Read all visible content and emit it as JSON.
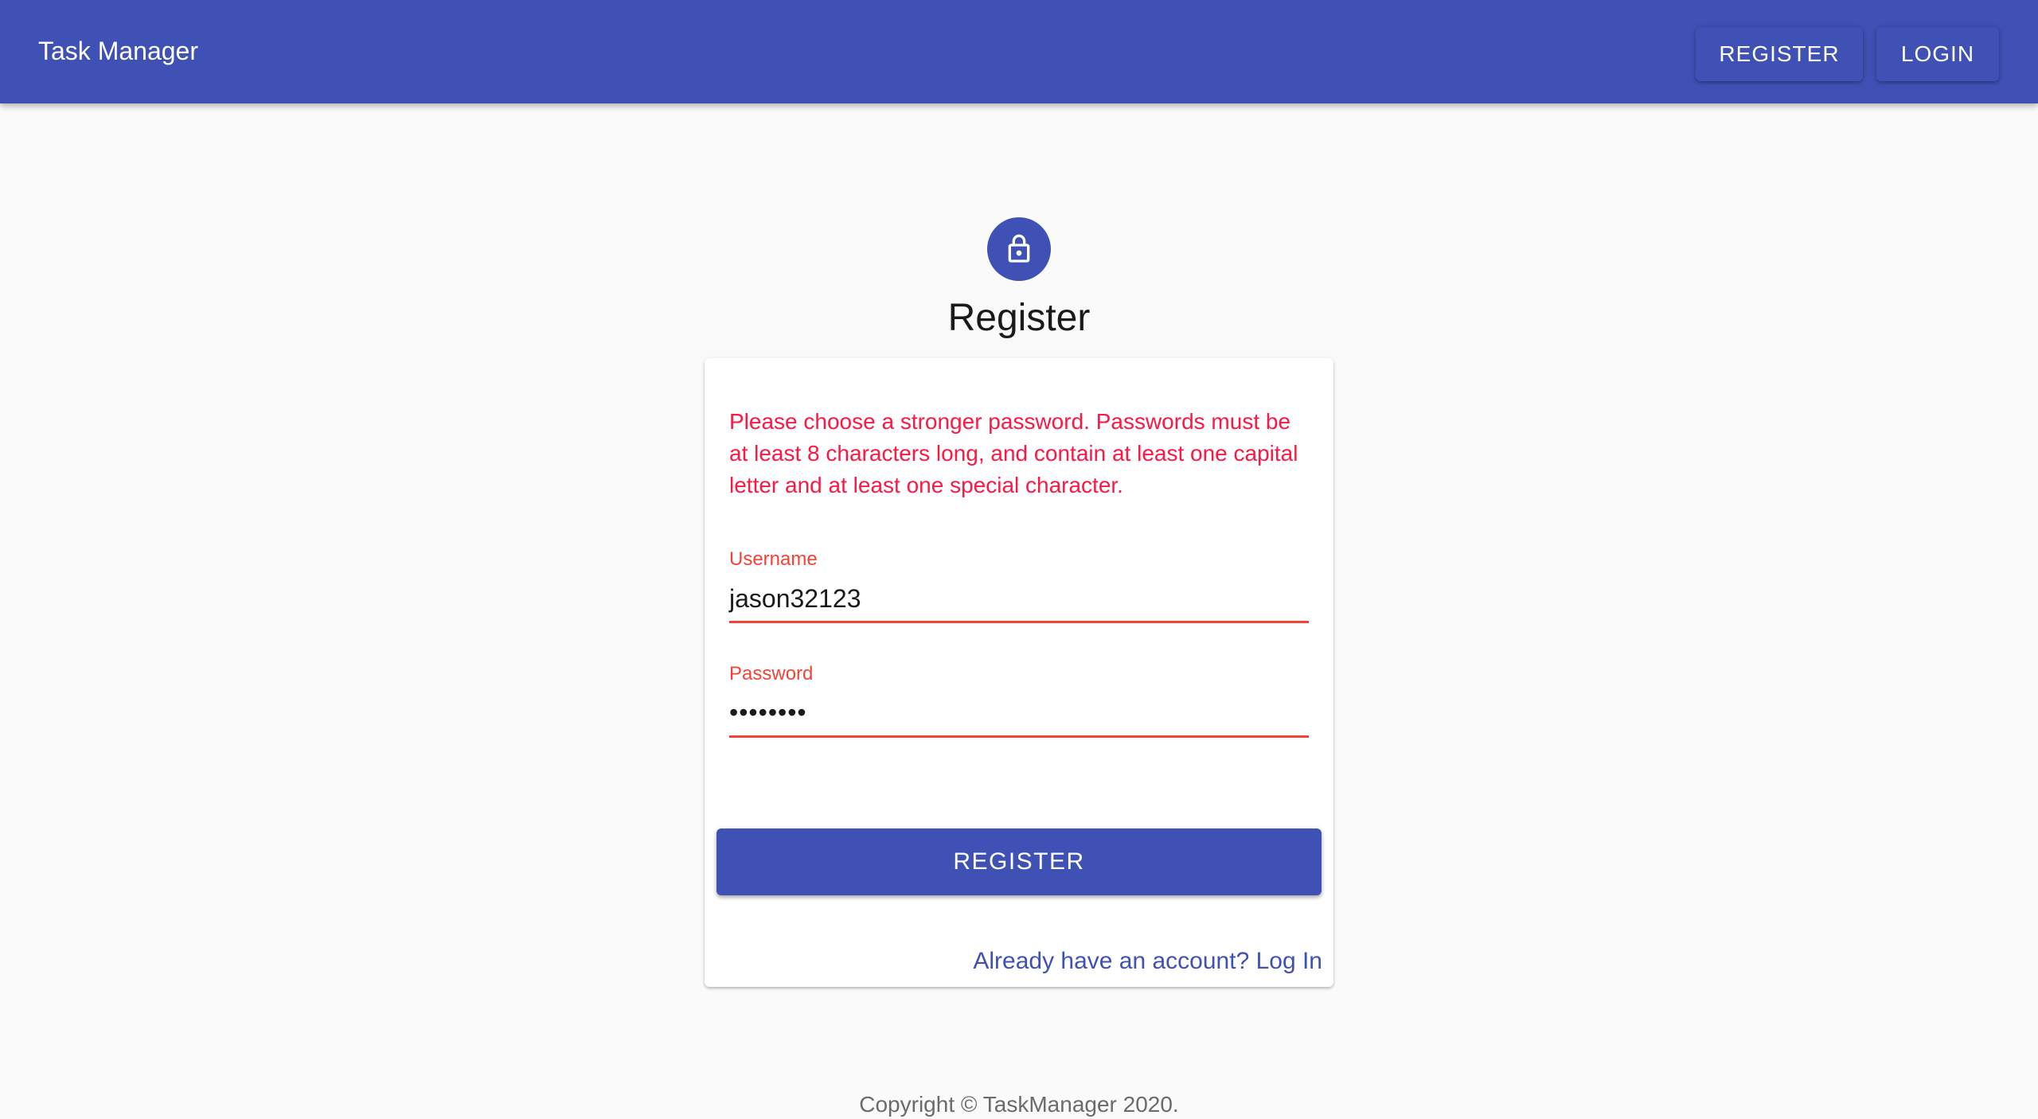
{
  "appbar": {
    "title": "Task Manager",
    "register_label": "REGISTER",
    "login_label": "LOGIN"
  },
  "form": {
    "heading": "Register",
    "error_message": "Please choose a stronger password. Passwords must be at least 8 characters long, and contain at least one capital letter and at least one special character.",
    "username_label": "Username",
    "username_value": "jason32123",
    "password_label": "Password",
    "password_value": "••••••••",
    "submit_label": "REGISTER",
    "login_link": "Already have an account? Log In"
  },
  "footer": {
    "copyright": "Copyright © TaskManager 2020."
  },
  "icons": {
    "avatar": "lock-icon"
  },
  "colors": {
    "primary": "#3f51b5",
    "error": "#f44336",
    "error_text": "#ff1744",
    "background": "#fafafa"
  }
}
